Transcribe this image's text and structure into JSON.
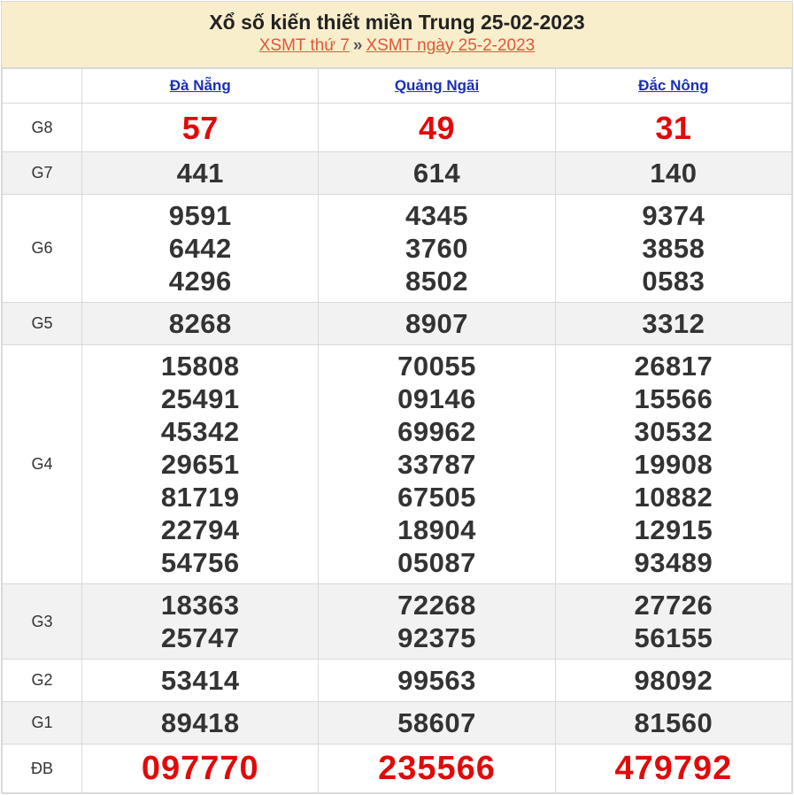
{
  "header": {
    "title": "Xổ số kiến thiết miền Trung 25-02-2023",
    "link_weekday": "XSMT thứ 7",
    "separator": "»",
    "link_date": "XSMT ngày 25-2-2023"
  },
  "provinces": [
    "Đà Nẵng",
    "Quảng Ngãi",
    "Đắc Nông"
  ],
  "prizes": [
    {
      "label": "G8",
      "values": [
        [
          "57"
        ],
        [
          "49"
        ],
        [
          "31"
        ]
      ]
    },
    {
      "label": "G7",
      "values": [
        [
          "441"
        ],
        [
          "614"
        ],
        [
          "140"
        ]
      ]
    },
    {
      "label": "G6",
      "values": [
        [
          "9591",
          "6442",
          "4296"
        ],
        [
          "4345",
          "3760",
          "8502"
        ],
        [
          "9374",
          "3858",
          "0583"
        ]
      ]
    },
    {
      "label": "G5",
      "values": [
        [
          "8268"
        ],
        [
          "8907"
        ],
        [
          "3312"
        ]
      ]
    },
    {
      "label": "G4",
      "values": [
        [
          "15808",
          "25491",
          "45342",
          "29651",
          "81719",
          "22794",
          "54756"
        ],
        [
          "70055",
          "09146",
          "69962",
          "33787",
          "67505",
          "18904",
          "05087"
        ],
        [
          "26817",
          "15566",
          "30532",
          "19908",
          "10882",
          "12915",
          "93489"
        ]
      ]
    },
    {
      "label": "G3",
      "values": [
        [
          "18363",
          "25747"
        ],
        [
          "72268",
          "92375"
        ],
        [
          "27726",
          "56155"
        ]
      ]
    },
    {
      "label": "G2",
      "values": [
        [
          "53414"
        ],
        [
          "99563"
        ],
        [
          "98092"
        ]
      ]
    },
    {
      "label": "G1",
      "values": [
        [
          "89418"
        ],
        [
          "58607"
        ],
        [
          "81560"
        ]
      ]
    },
    {
      "label": "ĐB",
      "values": [
        [
          "097770"
        ],
        [
          "235566"
        ],
        [
          "479792"
        ]
      ]
    }
  ],
  "colors": {
    "header_bg": "#f8eecb",
    "link_red": "#e4563a",
    "prize_red": "#e10a0a",
    "province_blue": "#1a2fb5",
    "alt_row_bg": "#f2f2f2"
  }
}
